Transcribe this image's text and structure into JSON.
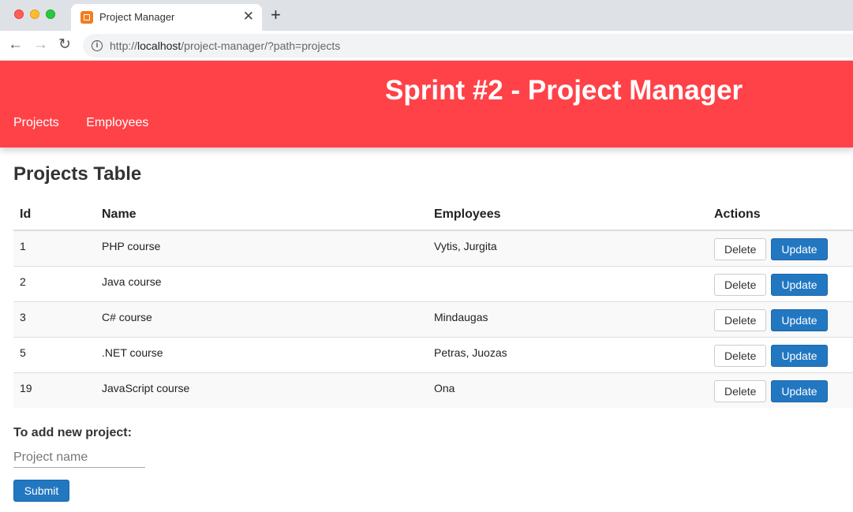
{
  "browser": {
    "tab_title": "Project Manager",
    "url_scheme": "http://",
    "url_host": "localhost",
    "url_path": "/project-manager/?path=projects"
  },
  "header": {
    "title": "Sprint #2 - Project Manager",
    "nav": [
      {
        "label": "Projects"
      },
      {
        "label": "Employees"
      }
    ],
    "color": "#ff4248"
  },
  "page": {
    "section_title": "Projects Table",
    "columns": [
      "Id",
      "Name",
      "Employees",
      "Actions"
    ],
    "rows": [
      {
        "id": "1",
        "name": "PHP course",
        "employees": "Vytis, Jurgita",
        "delete": "Delete",
        "update": "Update"
      },
      {
        "id": "2",
        "name": "Java course",
        "employees": "",
        "delete": "Delete",
        "update": "Update"
      },
      {
        "id": "3",
        "name": "C# course",
        "employees": "Mindaugas",
        "delete": "Delete",
        "update": "Update"
      },
      {
        "id": "5",
        "name": ".NET course",
        "employees": "Petras, Juozas",
        "delete": "Delete",
        "update": "Update"
      },
      {
        "id": "19",
        "name": "JavaScript course",
        "employees": "Ona",
        "delete": "Delete",
        "update": "Update"
      }
    ],
    "add_label": "To add new project:",
    "input_placeholder": "Project name",
    "input_value": "",
    "submit_label": "Submit",
    "accent": "#2277c1"
  }
}
